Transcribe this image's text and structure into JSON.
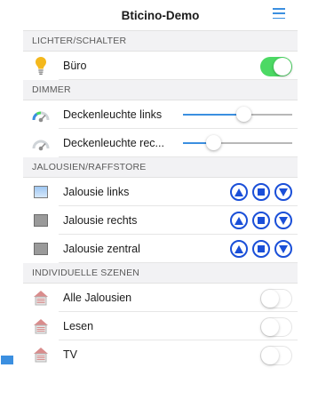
{
  "header": {
    "title": "Bticino-Demo",
    "menu_icon": "hamburger-menu-icon"
  },
  "colors": {
    "accent": "#3b8fe0",
    "toggle_on": "#4cd964",
    "control_blue": "#1a4fd8",
    "bulb": "#f4b81c"
  },
  "sections": {
    "lights": "LICHTER/SCHALTER",
    "dimmer": "DIMMER",
    "blinds": "JALOUSIEN/RAFFSTORE",
    "scenes": "INDIVIDUELLE SZENEN"
  },
  "lights": [
    {
      "label": "Büro",
      "icon": "light-bulb-icon",
      "on": true
    }
  ],
  "dimmers": [
    {
      "label": "Deckenleuchte links",
      "icon": "dimmer-gauge-icon",
      "level": 0.55
    },
    {
      "label": "Deckenleuchte rec...",
      "icon": "dimmer-gauge-icon",
      "level": 0.28
    }
  ],
  "blinds": [
    {
      "label": "Jalousie links",
      "icon": "blind-open-icon"
    },
    {
      "label": "Jalousie rechts",
      "icon": "blind-closed-icon"
    },
    {
      "label": "Jalousie zentral",
      "icon": "blind-closed-icon"
    }
  ],
  "blind_controls": [
    "up-arrow-icon",
    "stop-icon",
    "down-arrow-icon"
  ],
  "scenes": [
    {
      "label": "Alle Jalousien",
      "icon": "scene-house-icon",
      "on": false
    },
    {
      "label": "Lesen",
      "icon": "scene-house-icon",
      "on": false
    },
    {
      "label": "TV",
      "icon": "scene-house-icon",
      "on": false
    }
  ]
}
